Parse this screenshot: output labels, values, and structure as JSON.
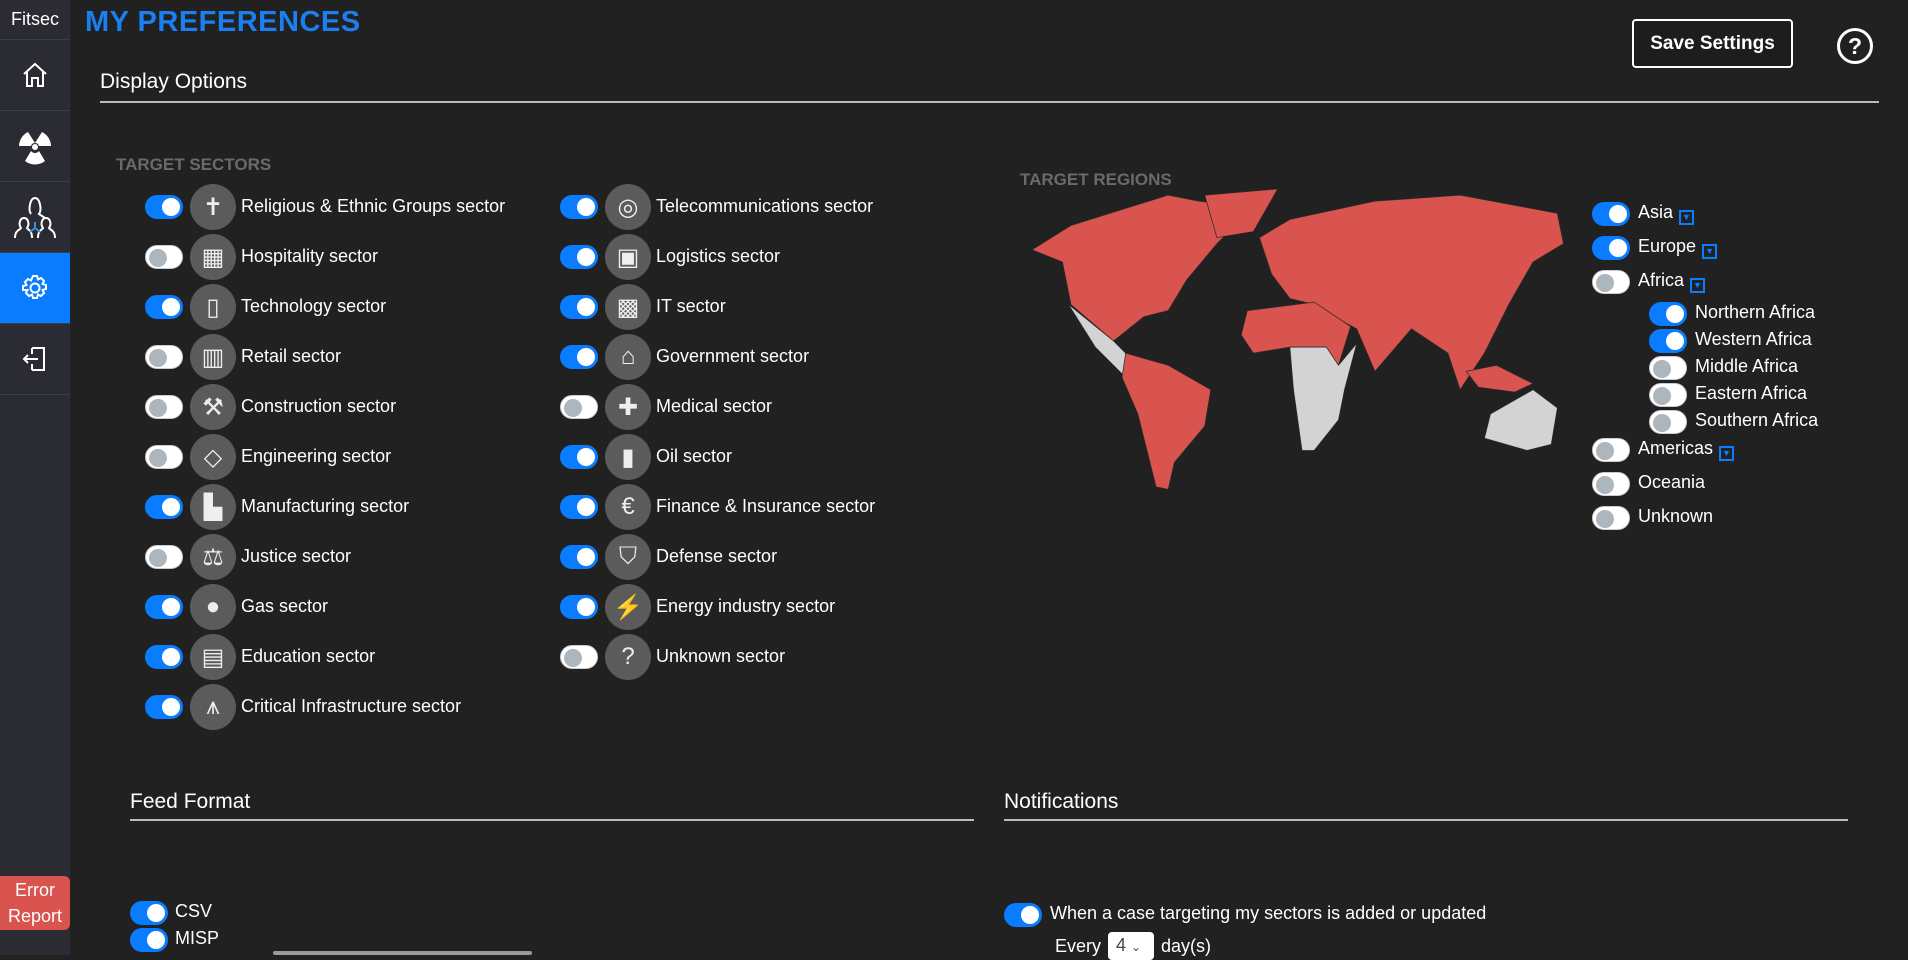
{
  "app": {
    "brand": "Fitsec",
    "title": "MY PREFERENCES",
    "save_label": "Save Settings",
    "help_label": "?",
    "error_report": "Error Report"
  },
  "sidebar": {
    "items": [
      {
        "icon": "home-icon"
      },
      {
        "icon": "radiation-icon"
      },
      {
        "icon": "network-icon"
      },
      {
        "icon": "gear-icon",
        "active": true
      },
      {
        "icon": "logout-icon"
      }
    ]
  },
  "display_options": {
    "heading": "Display Options",
    "sectors_caption": "TARGET SECTORS",
    "regions_caption": "TARGET REGIONS"
  },
  "sectors": {
    "col1": [
      {
        "label": "Religious & Ethnic Groups sector",
        "on": true,
        "icon": "church-icon"
      },
      {
        "label": "Hospitality sector",
        "on": false,
        "icon": "hotel-icon"
      },
      {
        "label": "Technology sector",
        "on": true,
        "icon": "tablet-icon"
      },
      {
        "label": "Retail sector",
        "on": false,
        "icon": "shop-icon"
      },
      {
        "label": "Construction sector",
        "on": false,
        "icon": "hammer-icon"
      },
      {
        "label": "Engineering sector",
        "on": false,
        "icon": "wrench-icon"
      },
      {
        "label": "Manufacturing sector",
        "on": true,
        "icon": "factory-icon"
      },
      {
        "label": "Justice sector",
        "on": false,
        "icon": "scales-icon"
      },
      {
        "label": "Gas sector",
        "on": true,
        "icon": "gas-cylinder-icon"
      },
      {
        "label": "Education sector",
        "on": true,
        "icon": "book-icon"
      },
      {
        "label": "Critical Infrastructure sector",
        "on": true,
        "icon": "power-tower-icon"
      }
    ],
    "col2": [
      {
        "label": "Telecommunications sector",
        "on": true,
        "icon": "antenna-icon"
      },
      {
        "label": "Logistics sector",
        "on": true,
        "icon": "package-icon"
      },
      {
        "label": "IT sector",
        "on": true,
        "icon": "computer-icon"
      },
      {
        "label": "Government sector",
        "on": true,
        "icon": "government-building-icon"
      },
      {
        "label": "Medical sector",
        "on": false,
        "icon": "medical-cross-icon"
      },
      {
        "label": "Oil sector",
        "on": true,
        "icon": "oil-barrel-icon"
      },
      {
        "label": "Finance & Insurance sector",
        "on": true,
        "icon": "euro-icon"
      },
      {
        "label": "Defense sector",
        "on": true,
        "icon": "shield-icon"
      },
      {
        "label": "Energy industry sector",
        "on": true,
        "icon": "lightning-icon"
      },
      {
        "label": "Unknown sector",
        "on": false,
        "icon": "question-icon"
      }
    ]
  },
  "regions": {
    "main": [
      {
        "label": "Asia",
        "on": true,
        "expand": true
      },
      {
        "label": "Europe",
        "on": true,
        "expand": true
      },
      {
        "label": "Africa",
        "on": false,
        "expand": true
      }
    ],
    "africa": [
      {
        "label": "Northern Africa",
        "on": true
      },
      {
        "label": "Western Africa",
        "on": true
      },
      {
        "label": "Middle Africa",
        "on": false
      },
      {
        "label": "Eastern Africa",
        "on": false
      },
      {
        "label": "Southern Africa",
        "on": false
      }
    ],
    "rest": [
      {
        "label": "Americas",
        "on": false,
        "expand": true
      },
      {
        "label": "Oceania",
        "on": false,
        "expand": false
      },
      {
        "label": "Unknown",
        "on": false,
        "expand": false
      }
    ],
    "map_colors": {
      "selected": "#d9534f",
      "unselected": "#d3d3d3"
    }
  },
  "feed_format": {
    "heading": "Feed Format",
    "items": [
      {
        "label": "CSV",
        "on": true
      },
      {
        "label": "MISP",
        "on": true
      }
    ]
  },
  "notifications": {
    "heading": "Notifications",
    "item": {
      "label": "When a case targeting my sectors is added or updated",
      "on": true
    },
    "every_label": "Every",
    "interval": "4",
    "unit_label": "day(s)"
  }
}
